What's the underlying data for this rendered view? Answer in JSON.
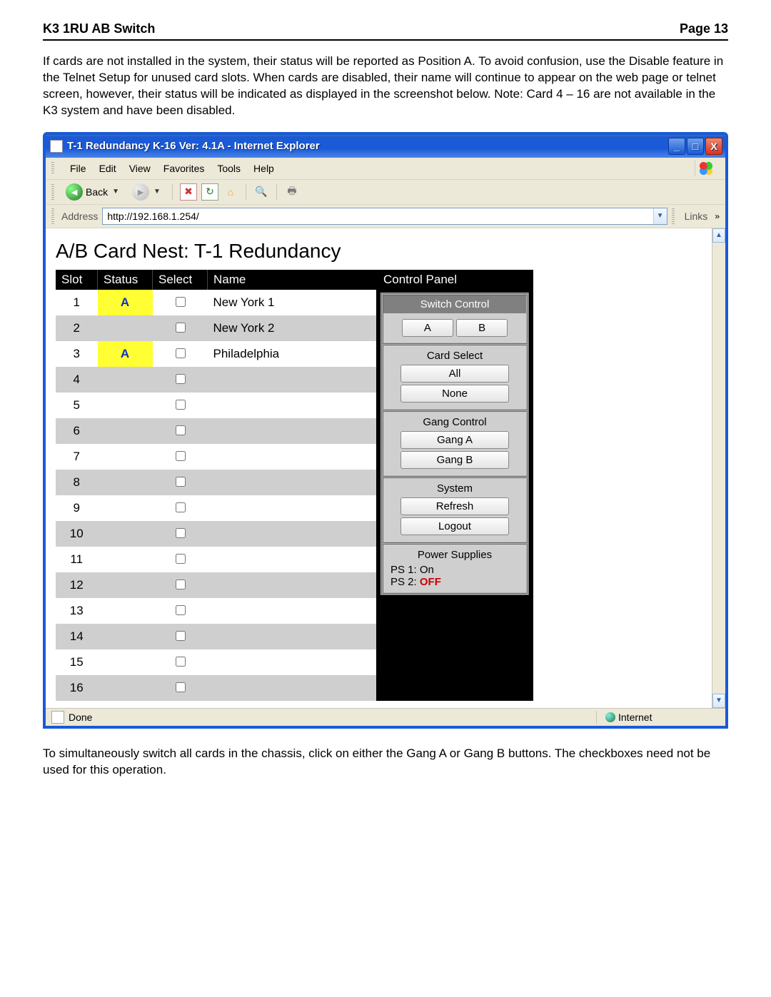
{
  "doc": {
    "header_left": "K3 1RU AB Switch",
    "header_right": "Page 13",
    "para1": "If cards are not installed in the system, their status will be reported as Position A.  To avoid confusion, use the Disable feature in the Telnet Setup for unused card slots.  When cards are disabled, their name will continue to appear on the web page or telnet screen, however, their status will be indicated as displayed in the screenshot below.  Note: Card 4 – 16 are not available in the K3 system and have been disabled.",
    "para2": "To simultaneously switch all cards in the chassis, click on either the Gang A or Gang B buttons.  The checkboxes need not be used for this operation."
  },
  "window": {
    "title": "T-1 Redundancy K-16 Ver: 4.1A - Internet Explorer",
    "minimize": "_",
    "maximize": "□",
    "close": "X"
  },
  "menu": {
    "file": "File",
    "edit": "Edit",
    "view": "View",
    "favorites": "Favorites",
    "tools": "Tools",
    "help": "Help"
  },
  "toolbar": {
    "back": "Back"
  },
  "address": {
    "label": "Address",
    "value": "http://192.168.1.254/",
    "links": "Links",
    "chevron": "»"
  },
  "page": {
    "title": "A/B Card Nest: T-1 Redundancy",
    "headers": {
      "slot": "Slot",
      "status": "Status",
      "select": "Select",
      "name": "Name"
    },
    "rows": [
      {
        "slot": "1",
        "status": "A",
        "name": "New York 1"
      },
      {
        "slot": "2",
        "status": "",
        "name": "New York 2"
      },
      {
        "slot": "3",
        "status": "A",
        "name": "Philadelphia"
      },
      {
        "slot": "4",
        "status": "",
        "name": ""
      },
      {
        "slot": "5",
        "status": "",
        "name": ""
      },
      {
        "slot": "6",
        "status": "",
        "name": ""
      },
      {
        "slot": "7",
        "status": "",
        "name": ""
      },
      {
        "slot": "8",
        "status": "",
        "name": ""
      },
      {
        "slot": "9",
        "status": "",
        "name": ""
      },
      {
        "slot": "10",
        "status": "",
        "name": ""
      },
      {
        "slot": "11",
        "status": "",
        "name": ""
      },
      {
        "slot": "12",
        "status": "",
        "name": ""
      },
      {
        "slot": "13",
        "status": "",
        "name": ""
      },
      {
        "slot": "14",
        "status": "",
        "name": ""
      },
      {
        "slot": "15",
        "status": "",
        "name": ""
      },
      {
        "slot": "16",
        "status": "",
        "name": ""
      }
    ]
  },
  "cp": {
    "header": "Control Panel",
    "switch_title": "Switch Control",
    "btn_a": "A",
    "btn_b": "B",
    "card_select_title": "Card Select",
    "btn_all": "All",
    "btn_none": "None",
    "gang_title": "Gang Control",
    "btn_gang_a": "Gang A",
    "btn_gang_b": "Gang B",
    "system_title": "System",
    "btn_refresh": "Refresh",
    "btn_logout": "Logout",
    "ps_title": "Power Supplies",
    "ps1_label": "PS 1: ",
    "ps1_value": "On",
    "ps2_label": "PS 2: ",
    "ps2_value": "OFF"
  },
  "status": {
    "done": "Done",
    "zone": "Internet"
  }
}
